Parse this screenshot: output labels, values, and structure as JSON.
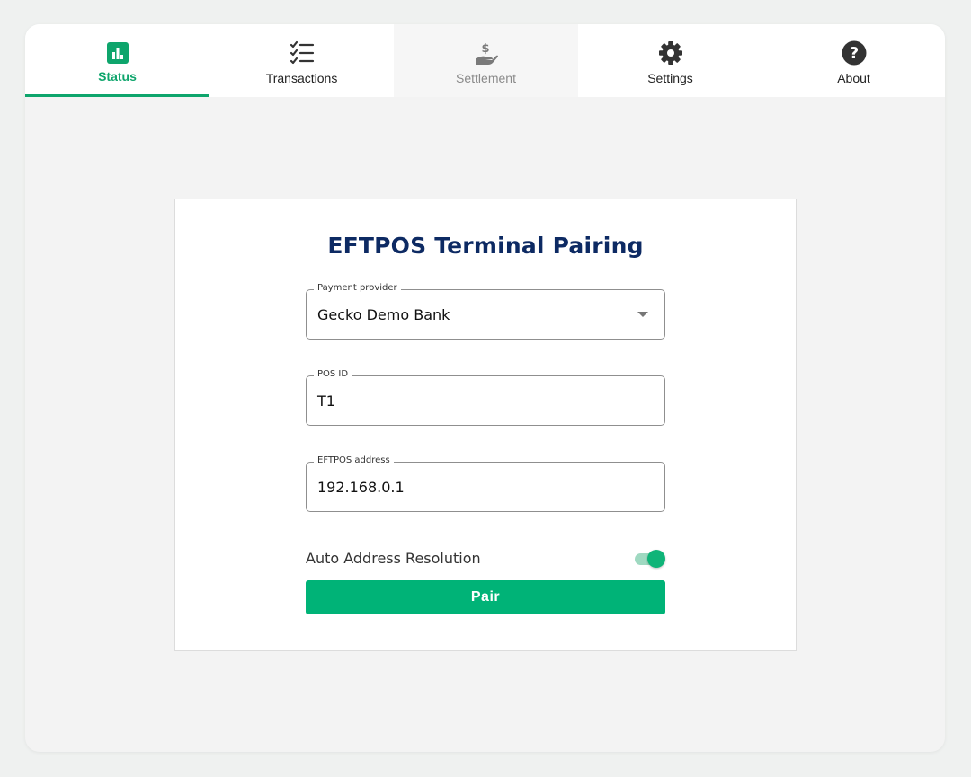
{
  "colors": {
    "accent": "#0ea56c",
    "title": "#0d2a63",
    "button": "#00b377"
  },
  "tabs": [
    {
      "label": "Status",
      "icon": "bar-chart-icon",
      "state": "active"
    },
    {
      "label": "Transactions",
      "icon": "checklist-icon",
      "state": "normal"
    },
    {
      "label": "Settlement",
      "icon": "hand-dollar-icon",
      "state": "disabled"
    },
    {
      "label": "Settings",
      "icon": "gear-icon",
      "state": "normal"
    },
    {
      "label": "About",
      "icon": "help-circle-icon",
      "state": "normal"
    }
  ],
  "card": {
    "title": "EFTPOS Terminal Pairing",
    "provider": {
      "label": "Payment provider",
      "value": "Gecko Demo Bank"
    },
    "pos_id": {
      "label": "POS ID",
      "value": "T1"
    },
    "address": {
      "label": "EFTPOS address",
      "value": "192.168.0.1"
    },
    "auto_resolution": {
      "label": "Auto Address Resolution",
      "enabled": true
    },
    "pair_label": "Pair"
  }
}
